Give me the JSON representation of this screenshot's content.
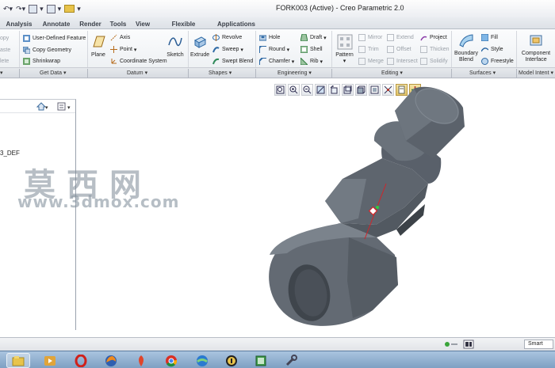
{
  "window": {
    "title": "FORK003 (Active) - Creo Parametric 2.0"
  },
  "tabs": [
    {
      "label": "Analysis"
    },
    {
      "label": "Annotate"
    },
    {
      "label": "Render"
    },
    {
      "label": "Tools"
    },
    {
      "label": "View"
    },
    {
      "label": "Flexible Modeling"
    },
    {
      "label": "Applications"
    }
  ],
  "ribbon": {
    "clipped": {
      "copy": "opy",
      "paste": "aste",
      "delete": "lete"
    },
    "get_data": {
      "user_defined_feature": "User-Defined Feature",
      "copy_geometry": "Copy Geometry",
      "shrinkwrap": "Shrinkwrap"
    },
    "datum": {
      "plane": "Plane",
      "axis": "Axis",
      "point": "Point",
      "coordinate_system": "Coordinate System",
      "sketch": "Sketch"
    },
    "shapes": {
      "extrude": "Extrude",
      "revolve": "Revolve",
      "sweep": "Sweep",
      "swept_blend": "Swept Blend"
    },
    "engineering": {
      "hole": "Hole",
      "round": "Round",
      "chamfer": "Chamfer",
      "draft": "Draft",
      "shell": "Shell",
      "rib": "Rib"
    },
    "editing": {
      "pattern": "Pattern",
      "mirror": "Mirror",
      "trim": "Trim",
      "merge": "Merge",
      "extend": "Extend",
      "offset": "Offset",
      "intersect": "Intersect",
      "project": "Project",
      "thicken": "Thicken",
      "solidify": "Solidify"
    },
    "surfaces": {
      "boundary": "Boundary",
      "blend": "Blend",
      "fill": "Fill",
      "style": "Style",
      "freestyle": "Freestyle"
    },
    "model_intent": {
      "component": "Component",
      "interface": "Interface"
    },
    "groups": {
      "get_data": "Get Data",
      "datum": "Datum",
      "shapes": "Shapes",
      "engineering": "Engineering",
      "editing": "Editing",
      "surfaces": "Surfaces",
      "model_intent": "Model Intent"
    }
  },
  "model_tree": {
    "visible_item": "3_DEF"
  },
  "watermark": {
    "chinese": "莫西网",
    "url": "www.3dmox.com"
  },
  "status": {
    "filter": "Smart"
  }
}
